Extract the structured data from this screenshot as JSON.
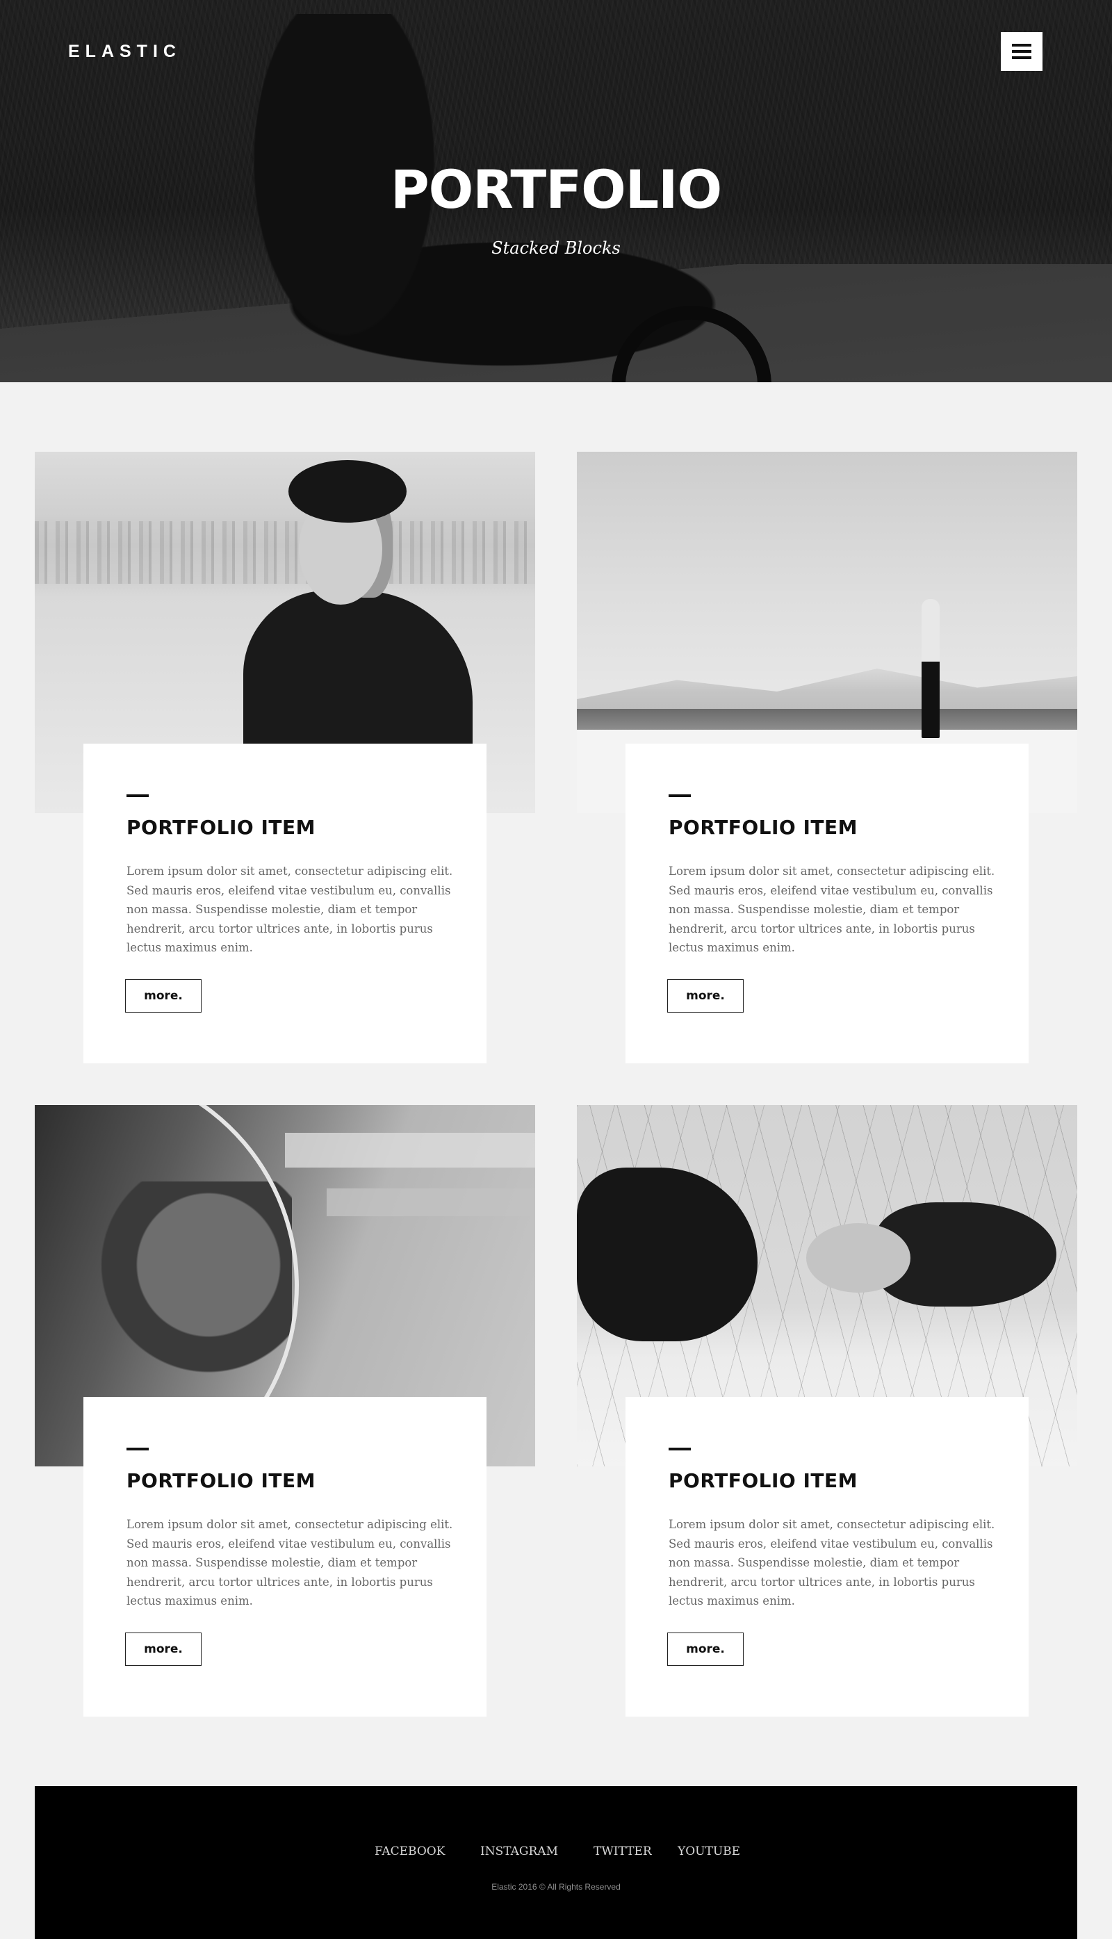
{
  "header": {
    "logo": "ELASTIC",
    "title": "PORTFOLIO",
    "subtitle": "Stacked Blocks",
    "menu_icon": "hamburger-menu-icon"
  },
  "items": [
    {
      "title": "PORTFOLIO ITEM",
      "text": "Lorem ipsum dolor sit amet, consectetur adipiscing elit. Sed mauris eros, eleifend vitae vestibulum eu, convallis non massa. Suspendisse molestie, diam et tempor hendrerit, arcu tortor ultrices ante, in lobortis purus lectus maximus enim.",
      "button": "more."
    },
    {
      "title": "PORTFOLIO ITEM",
      "text": "Lorem ipsum dolor sit amet, consectetur adipiscing elit. Sed mauris eros, eleifend vitae vestibulum eu, convallis non massa. Suspendisse molestie, diam et tempor hendrerit, arcu tortor ultrices ante, in lobortis purus lectus maximus enim.",
      "button": "more."
    },
    {
      "title": "PORTFOLIO ITEM",
      "text": "Lorem ipsum dolor sit amet, consectetur adipiscing elit. Sed mauris eros, eleifend vitae vestibulum eu, convallis non massa. Suspendisse molestie, diam et tempor hendrerit, arcu tortor ultrices ante, in lobortis purus lectus maximus enim.",
      "button": "more."
    },
    {
      "title": "PORTFOLIO ITEM",
      "text": "Lorem ipsum dolor sit amet, consectetur adipiscing elit. Sed mauris eros, eleifend vitae vestibulum eu, convallis non massa. Suspendisse molestie, diam et tempor hendrerit, arcu tortor ultrices ante, in lobortis purus lectus maximus enim.",
      "button": "more."
    }
  ],
  "footer": {
    "links": [
      "FACEBOOK",
      "INSTAGRAM",
      "TWITTER",
      "YOUTUBE"
    ],
    "copyright": "Elastic 2016 © All Rights Reserved"
  }
}
